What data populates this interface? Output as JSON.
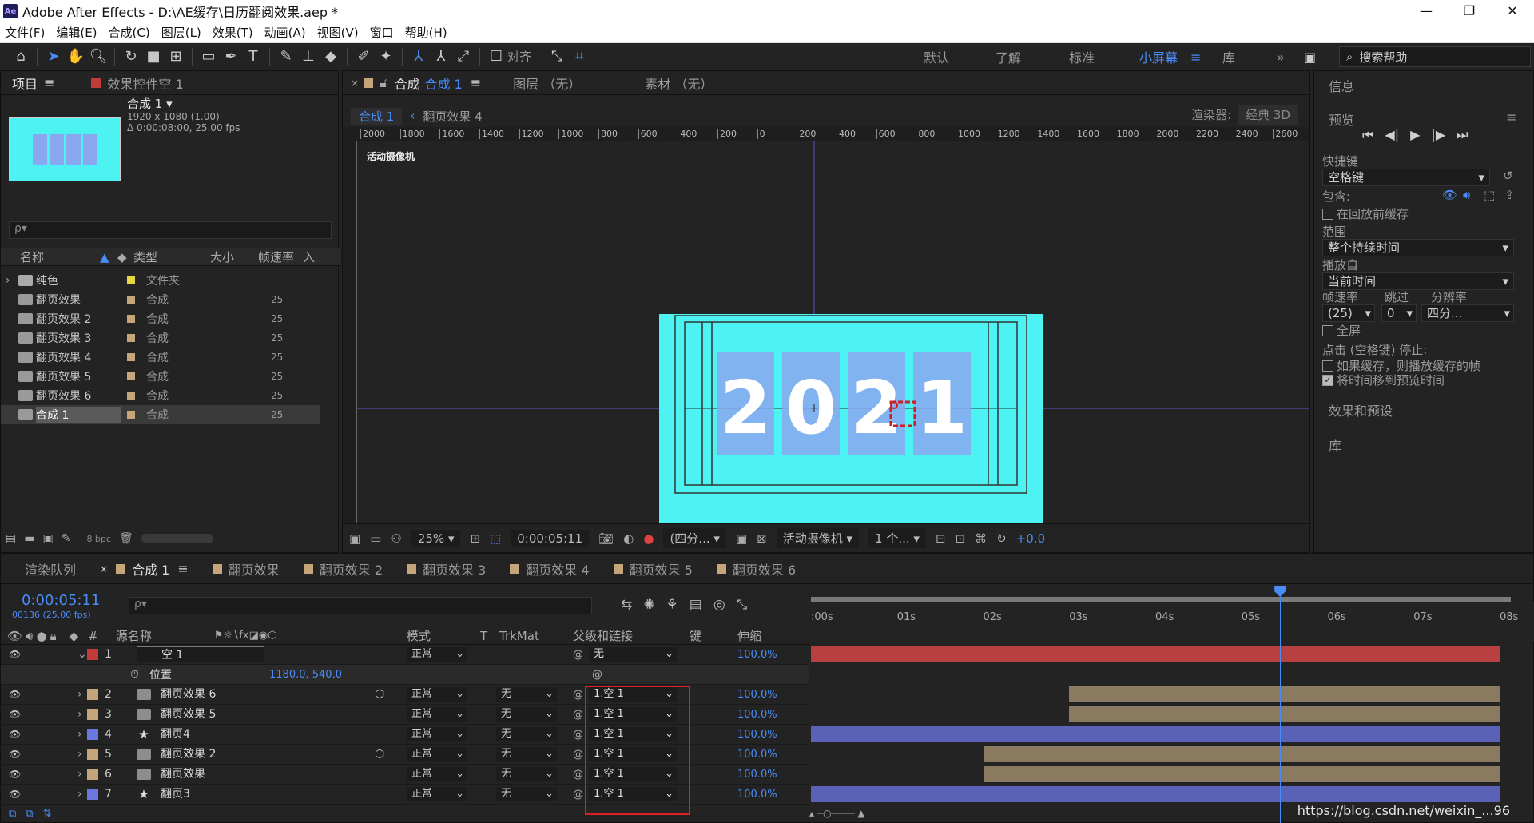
{
  "window": {
    "title": "Adobe After Effects - D:\\AE缓存\\日历翻阅效果.aep *",
    "minimize": "—",
    "maximize": "❐",
    "close": "✕"
  },
  "menu": [
    "文件(F)",
    "编辑(E)",
    "合成(C)",
    "图层(L)",
    "效果(T)",
    "动画(A)",
    "视图(V)",
    "窗口",
    "帮助(H)"
  ],
  "toolbar": {
    "align_label": "对齐",
    "workspaces": [
      "默认",
      "了解",
      "标准",
      "小屏幕",
      "库"
    ],
    "active_workspace": "小屏幕",
    "search_placeholder": "搜索帮助"
  },
  "project": {
    "tab_project": "项目",
    "tab_effects": "效果控件空 1",
    "comp_name": "合成 1",
    "comp_dims": "1920 x 1080 (1.00)",
    "comp_duration": "Δ 0:00:08:00, 25.00 fps",
    "search_placeholder": "ρ▾",
    "columns": [
      "名称",
      "类型",
      "大小",
      "帧速率",
      "入"
    ],
    "items": [
      {
        "name": "纯色",
        "type": "文件夹",
        "fps": "",
        "color": "#e8d640"
      },
      {
        "name": "翻页效果",
        "type": "合成",
        "fps": "25",
        "color": "#c4a67a"
      },
      {
        "name": "翻页效果 2",
        "type": "合成",
        "fps": "25",
        "color": "#c4a67a"
      },
      {
        "name": "翻页效果 3",
        "type": "合成",
        "fps": "25",
        "color": "#c4a67a"
      },
      {
        "name": "翻页效果 4",
        "type": "合成",
        "fps": "25",
        "color": "#c4a67a"
      },
      {
        "name": "翻页效果 5",
        "type": "合成",
        "fps": "25",
        "color": "#c4a67a"
      },
      {
        "name": "翻页效果 6",
        "type": "合成",
        "fps": "25",
        "color": "#c4a67a"
      },
      {
        "name": "合成 1",
        "type": "合成",
        "fps": "25",
        "color": "#c4a67a"
      }
    ],
    "bpc": "8 bpc"
  },
  "viewer": {
    "tab_comp": "合成",
    "tab_comp_name": "合成 1",
    "tab_layer": "图层 （无）",
    "tab_footage": "素材 （无）",
    "breadcrumb_active": "合成 1",
    "breadcrumb_other": "翻页效果 4",
    "renderer_label": "渲染器:",
    "renderer_value": "经典 3D",
    "ruler_ticks": [
      "2000",
      "1800",
      "1600",
      "1400",
      "1200",
      "1000",
      "800",
      "600",
      "400",
      "200",
      "0",
      "200",
      "400",
      "600",
      "800",
      "1000",
      "1200",
      "1400",
      "1600",
      "1800",
      "2000",
      "2200",
      "2400",
      "2600"
    ],
    "camera_label": "活动摄像机",
    "digits": [
      "2",
      "0",
      "2",
      "1"
    ],
    "zoom": "25%",
    "timecode": "0:00:05:11",
    "resolution": "(四分...",
    "camera_select": "活动摄像机",
    "views": "1 个...",
    "exposure": "+0.0"
  },
  "right": {
    "info_title": "信息",
    "preview_title": "预览",
    "shortcut_label": "快捷键",
    "shortcut_value": "空格键",
    "include_label": "包含:",
    "cache_before": "在回放前缓存",
    "range_label": "范围",
    "range_value": "整个持续时间",
    "play_from_label": "播放自",
    "play_from_value": "当前时间",
    "framerate_label": "帧速率",
    "skip_label": "跳过",
    "resolution_label": "分辨率",
    "framerate_value": "(25)",
    "skip_value": "0",
    "resolution_value": "四分...",
    "fullscreen": "全屏",
    "stop_label": "点击 (空格键) 停止:",
    "stop_opt1": "如果缓存，则播放缓存的帧",
    "stop_opt2": "将时间移到预览时间",
    "effects_title": "效果和预设",
    "library_title": "库"
  },
  "timeline": {
    "tabs": [
      {
        "label": "渲染队列",
        "color": ""
      },
      {
        "label": "合成 1",
        "color": "#c4a67a"
      },
      {
        "label": "翻页效果",
        "color": "#c4a67a"
      },
      {
        "label": "翻页效果 2",
        "color": "#c4a67a"
      },
      {
        "label": "翻页效果 3",
        "color": "#c4a67a"
      },
      {
        "label": "翻页效果 4",
        "color": "#c4a67a"
      },
      {
        "label": "翻页效果 5",
        "color": "#c4a67a"
      },
      {
        "label": "翻页效果 6",
        "color": "#c4a67a"
      }
    ],
    "timecode": "0:00:05:11",
    "frames": "00136 (25.00 fps)",
    "search_placeholder": "ρ▾",
    "headers": {
      "source": "源名称",
      "mode": "模式",
      "t": "T",
      "trkmat": "TrkMat",
      "parent": "父级和链接",
      "keys": "键",
      "stretch": "伸缩"
    },
    "time_ticks": [
      ":00s",
      "01s",
      "02s",
      "03s",
      "04s",
      "05s",
      "06s",
      "07s",
      "08s"
    ],
    "current_time_seconds": 5.44,
    "layers": [
      {
        "num": "1",
        "name": "空 1",
        "color": "#c23b3b",
        "mode": "正常",
        "trkmat": "",
        "parent": "无",
        "stretch": "100.0%",
        "icon": "null",
        "bar_color": "#b84040",
        "bar_start": 0.0,
        "bar_end": 8.0
      },
      {
        "num": "2",
        "name": "翻页效果 6",
        "color": "#c4a67a",
        "mode": "正常",
        "trkmat": "无",
        "parent": "1.空 1",
        "stretch": "100.0%",
        "icon": "comp",
        "bar_color": "#8a7a60",
        "bar_start": 3.0,
        "bar_end": 8.0
      },
      {
        "num": "3",
        "name": "翻页效果 5",
        "color": "#c4a67a",
        "mode": "正常",
        "trkmat": "无",
        "parent": "1.空 1",
        "stretch": "100.0%",
        "icon": "comp",
        "bar_color": "#8a7a60",
        "bar_start": 3.0,
        "bar_end": 8.0
      },
      {
        "num": "4",
        "name": "翻页4",
        "color": "#6a78e0",
        "mode": "正常",
        "trkmat": "无",
        "parent": "1.空 1",
        "stretch": "100.0%",
        "icon": "star",
        "bar_color": "#5a62b8",
        "bar_start": 0.0,
        "bar_end": 8.0
      },
      {
        "num": "5",
        "name": "翻页效果 2",
        "color": "#c4a67a",
        "mode": "正常",
        "trkmat": "无",
        "parent": "1.空 1",
        "stretch": "100.0%",
        "icon": "comp",
        "bar_color": "#8a7a60",
        "bar_start": 2.0,
        "bar_end": 8.0
      },
      {
        "num": "6",
        "name": "翻页效果",
        "color": "#c4a67a",
        "mode": "正常",
        "trkmat": "无",
        "parent": "1.空 1",
        "stretch": "100.0%",
        "icon": "comp",
        "bar_color": "#8a7a60",
        "bar_start": 2.0,
        "bar_end": 8.0
      },
      {
        "num": "7",
        "name": "翻页3",
        "color": "#6a78e0",
        "mode": "正常",
        "trkmat": "无",
        "parent": "1.空 1",
        "stretch": "100.0%",
        "icon": "star",
        "bar_color": "#5a62b8",
        "bar_start": 0.0,
        "bar_end": 8.0
      }
    ],
    "position_label": "位置",
    "position_value": "1180.0, 540.0"
  },
  "watermark": "https://blog.csdn.net/weixin_...96"
}
